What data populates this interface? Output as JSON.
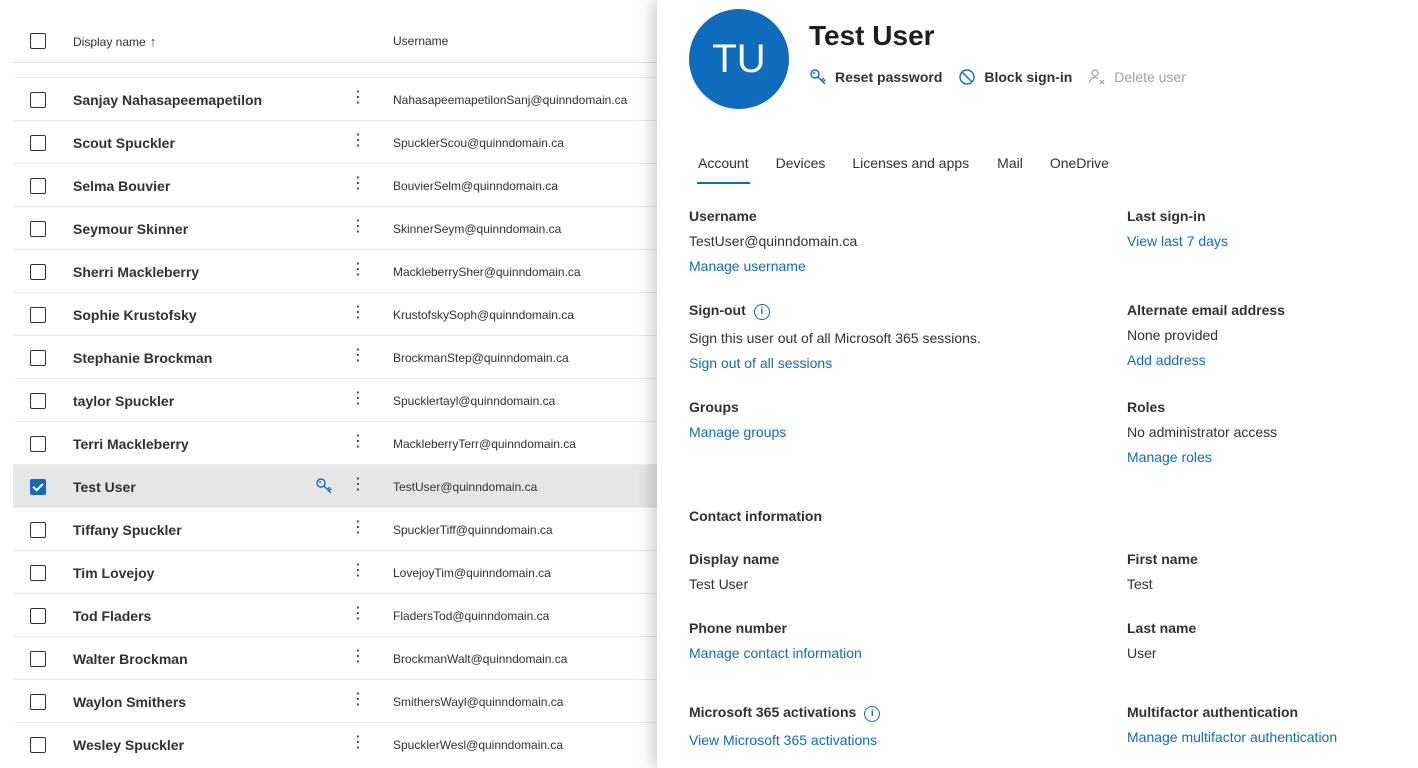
{
  "list": {
    "header": {
      "display_name": "Display name",
      "sort_arrow": "↑",
      "username": "Username"
    },
    "rows": [
      {
        "name": "Sanjay Nahasapeemapetilon",
        "username": "NahasapeemapetilonSanj@quinndomain.ca",
        "checked": false
      },
      {
        "name": "Scout Spuckler",
        "username": "SpucklerScou@quinndomain.ca",
        "checked": false
      },
      {
        "name": "Selma Bouvier",
        "username": "BouvierSelm@quinndomain.ca",
        "checked": false
      },
      {
        "name": "Seymour Skinner",
        "username": "SkinnerSeym@quinndomain.ca",
        "checked": false
      },
      {
        "name": "Sherri Mackleberry",
        "username": "MackleberrySher@quinndomain.ca",
        "checked": false
      },
      {
        "name": "Sophie Krustofsky",
        "username": "KrustofskySoph@quinndomain.ca",
        "checked": false
      },
      {
        "name": "Stephanie Brockman",
        "username": "BrockmanStep@quinndomain.ca",
        "checked": false
      },
      {
        "name": "taylor Spuckler",
        "username": "Spucklertayl@quinndomain.ca",
        "checked": false
      },
      {
        "name": "Terri Mackleberry",
        "username": "MackleberryTerr@quinndomain.ca",
        "checked": false
      },
      {
        "name": "Test User",
        "username": "TestUser@quinndomain.ca",
        "checked": true
      },
      {
        "name": "Tiffany Spuckler",
        "username": "SpucklerTiff@quinndomain.ca",
        "checked": false
      },
      {
        "name": "Tim Lovejoy",
        "username": "LovejoyTim@quinndomain.ca",
        "checked": false
      },
      {
        "name": "Tod Fladers",
        "username": "FladersTod@quinndomain.ca",
        "checked": false
      },
      {
        "name": "Walter Brockman",
        "username": "BrockmanWalt@quinndomain.ca",
        "checked": false
      },
      {
        "name": "Waylon Smithers",
        "username": "SmithersWayl@quinndomain.ca",
        "checked": false
      },
      {
        "name": "Wesley Spuckler",
        "username": "SpucklerWesl@quinndomain.ca",
        "checked": false
      }
    ]
  },
  "panel": {
    "initials": "TU",
    "title": "Test User",
    "actions": {
      "reset_password": "Reset password",
      "block_signin": "Block sign-in",
      "delete_user": "Delete user"
    },
    "tabs": [
      "Account",
      "Devices",
      "Licenses and apps",
      "Mail",
      "OneDrive"
    ],
    "active_tab": "Account",
    "username": {
      "label": "Username",
      "value": "TestUser@quinndomain.ca",
      "link": "Manage username"
    },
    "last_signin": {
      "label": "Last sign-in",
      "link": "View last 7 days"
    },
    "signout": {
      "label": "Sign-out",
      "text": "Sign this user out of all Microsoft 365 sessions.",
      "link": "Sign out of all sessions"
    },
    "alt_email": {
      "label": "Alternate email address",
      "value": "None provided",
      "link": "Add address"
    },
    "groups": {
      "label": "Groups",
      "link": "Manage groups"
    },
    "roles": {
      "label": "Roles",
      "value": "No administrator access",
      "link": "Manage roles"
    },
    "contact_heading": "Contact information",
    "display_name": {
      "label": "Display name",
      "value": "Test User"
    },
    "first_name": {
      "label": "First name",
      "value": "Test"
    },
    "phone": {
      "label": "Phone number",
      "link": "Manage contact information"
    },
    "last_name": {
      "label": "Last name",
      "value": "User"
    },
    "activations": {
      "label": "Microsoft 365 activations",
      "link": "View Microsoft 365 activations"
    },
    "mfa": {
      "label": "Multifactor authentication",
      "link": "Manage multifactor authentication"
    }
  },
  "colors": {
    "accent": "#0f6cbd",
    "selected_row": "#e6e6e6"
  }
}
